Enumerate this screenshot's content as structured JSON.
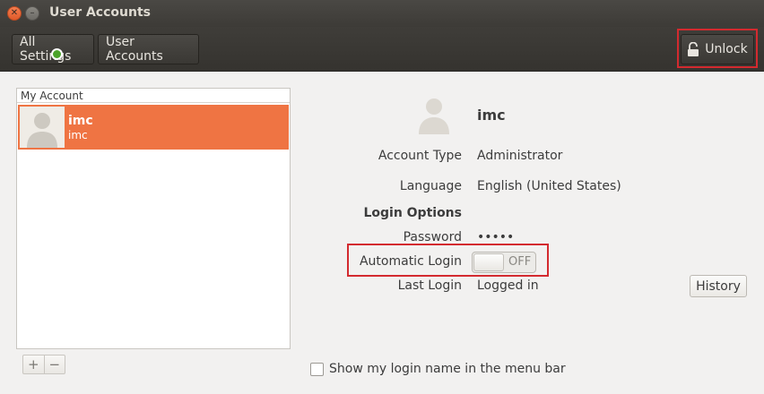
{
  "window": {
    "title": "User Accounts"
  },
  "toolbar": {
    "all_settings": "All Settings",
    "user_accounts": "User Accounts",
    "unlock": "Unlock"
  },
  "accounts_panel": {
    "header": "My Account",
    "items": [
      {
        "name": "imc",
        "username": "imc",
        "status": "online"
      }
    ],
    "add_label": "+",
    "remove_label": "−"
  },
  "details": {
    "name": "imc",
    "account_type_label": "Account Type",
    "account_type_value": "Administrator",
    "language_label": "Language",
    "language_value": "English (United States)",
    "login_options_label": "Login Options",
    "password_label": "Password",
    "password_value": "•••••",
    "automatic_login_label": "Automatic Login",
    "automatic_login_state": "OFF",
    "last_login_label": "Last Login",
    "last_login_value": "Logged in",
    "history_button": "History"
  },
  "show_login_name": {
    "label": "Show my login name in the menu bar",
    "checked": false
  },
  "colors": {
    "accent": "#ef7443",
    "highlight_frame": "#d32a2f",
    "online": "#4ba32a"
  }
}
